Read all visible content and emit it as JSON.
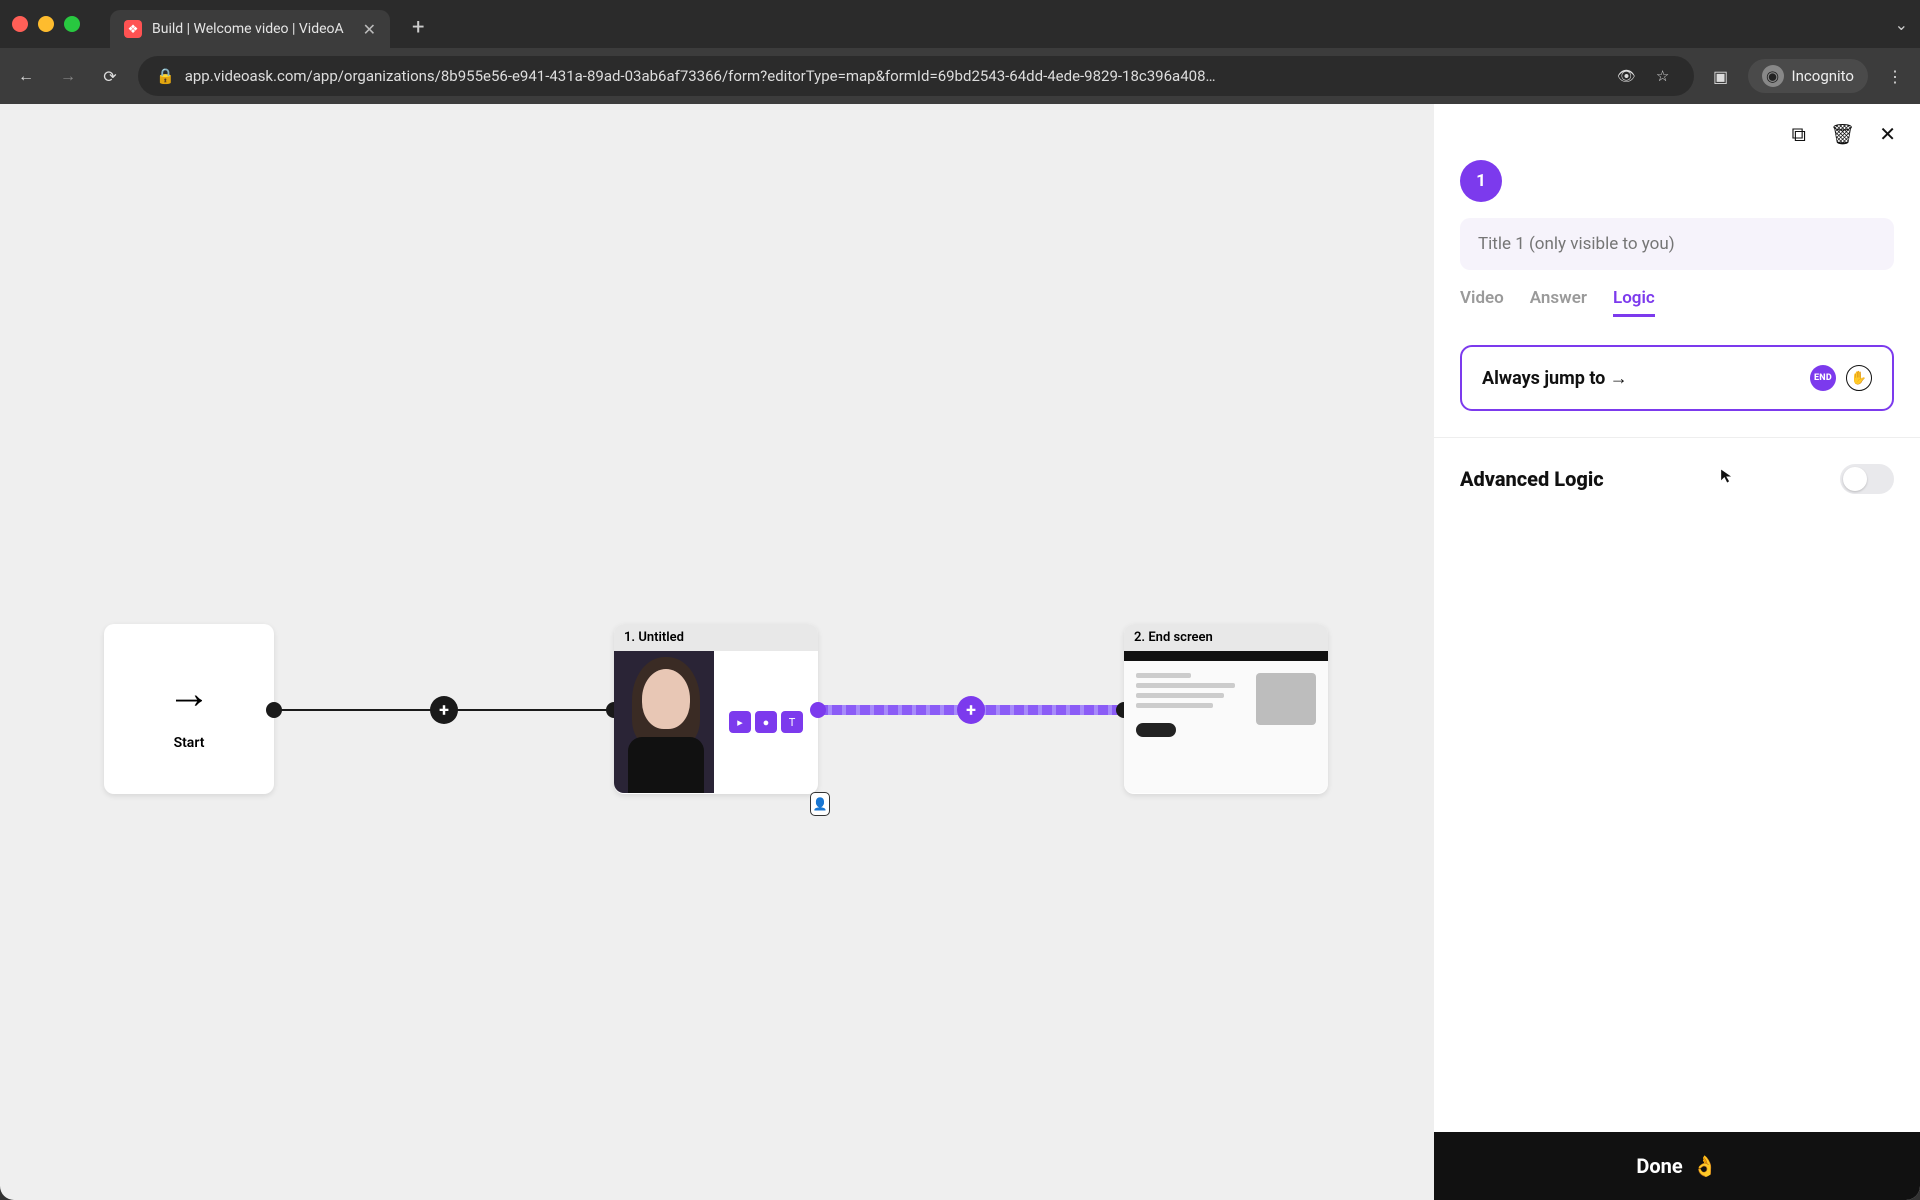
{
  "browser": {
    "tab_title": "Build | Welcome video | VideoA",
    "url": "app.videoask.com/app/organizations/8b955e56-e941-431a-89ad-03ab6af73366/form?editorType=map&formId=69bd2543-64dd-4ede-9829-18c396a408…",
    "incognito_label": "Incognito"
  },
  "canvas": {
    "start_label": "Start",
    "step1": {
      "title": "1. Untitled"
    },
    "step2": {
      "title": "2. End screen"
    }
  },
  "sidebar": {
    "step_number": "1",
    "title_placeholder": "Title 1 (only visible to you)",
    "tabs": {
      "video": "Video",
      "answer": "Answer",
      "logic": "Logic"
    },
    "jump_label": "Always jump to →",
    "jump_end_chip": "END",
    "advanced_label": "Advanced Logic",
    "done_label": "Done",
    "done_emoji": "👌"
  }
}
